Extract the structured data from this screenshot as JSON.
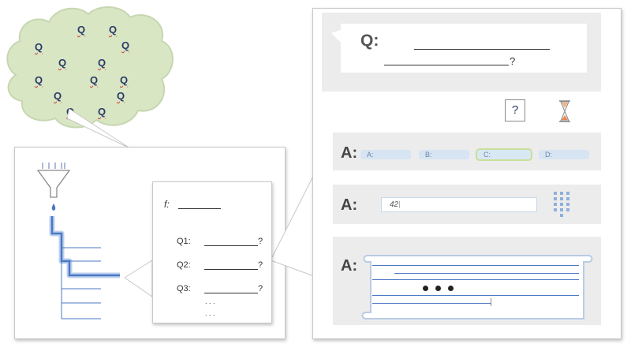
{
  "cloud": {
    "letter": "Q",
    "count": 14
  },
  "middle_card": {
    "formula_label": "f:",
    "questions": [
      {
        "label": "Q1:",
        "mark": "?"
      },
      {
        "label": "Q2:",
        "mark": "?"
      },
      {
        "label": "Q3:",
        "mark": "?"
      }
    ],
    "more1": ". . .",
    "more2": ". . ."
  },
  "question_box": {
    "label": "Q:",
    "mark": "?"
  },
  "help_icon": {
    "glyph": "?"
  },
  "choice_row": {
    "label": "A:",
    "options": [
      "A:",
      "B:",
      "C:",
      "D:"
    ],
    "selected": "C:"
  },
  "number_row": {
    "label": "A:",
    "value": "42"
  },
  "text_row": {
    "label": "A:"
  },
  "colors": {
    "accent": "#4a78c4",
    "cloud_fill": "#d8e6c4",
    "selected_outline": "#c9df9a"
  }
}
